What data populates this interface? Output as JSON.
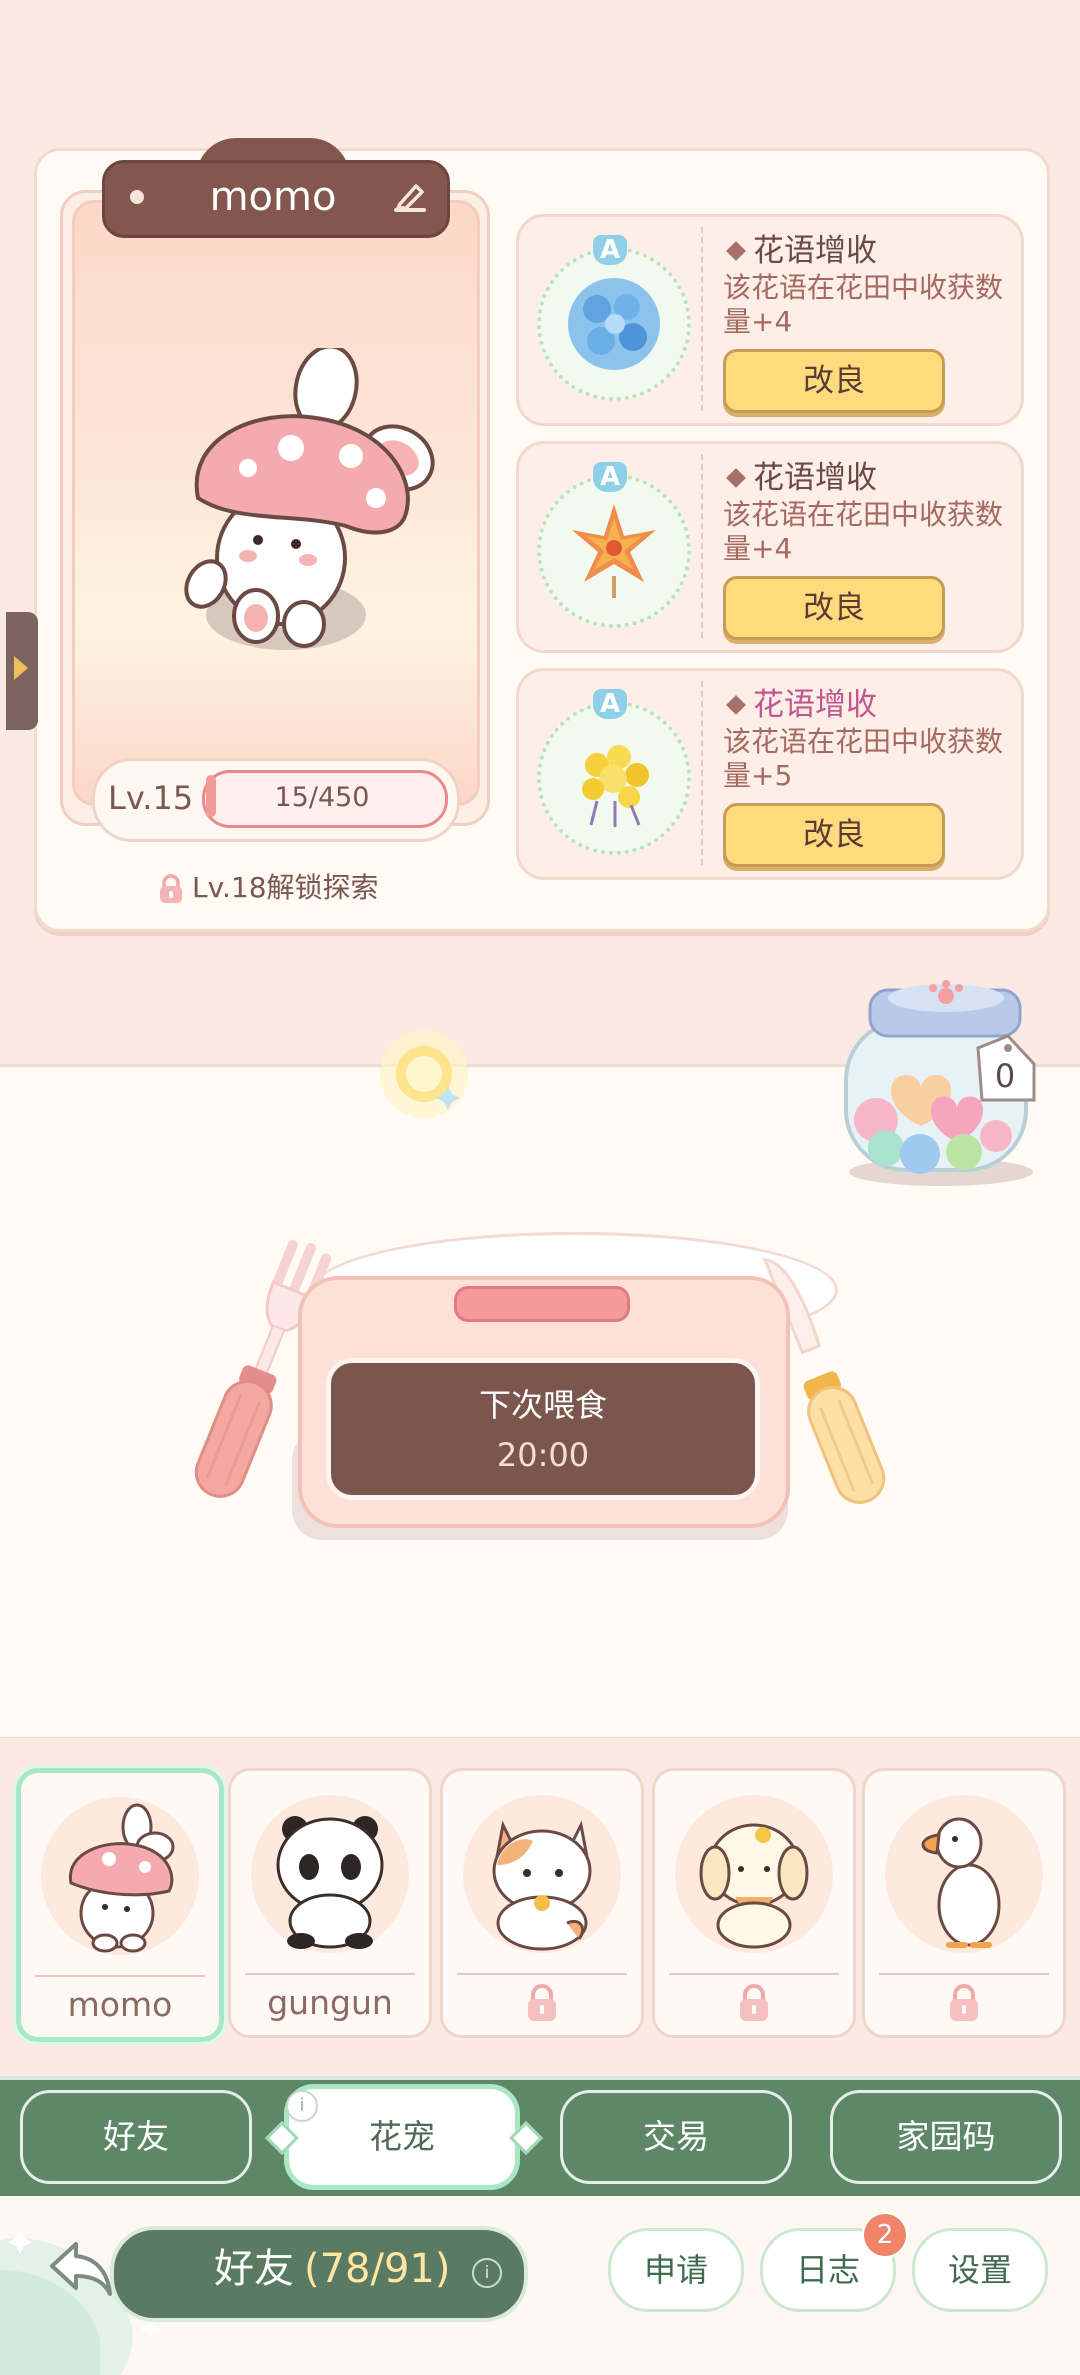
{
  "pet": {
    "name": "momo",
    "level_label": "Lv.15",
    "exp_text": "15/450",
    "exp_fraction": 0.033,
    "unlock_hint": "Lv.18解锁探索"
  },
  "traits": [
    {
      "grade": "A",
      "title": "花语增收",
      "title_color": "#6b4a44",
      "desc": "该花语在花田中收获数量+4",
      "button": "改良",
      "flower": "blue-hydrangea"
    },
    {
      "grade": "A",
      "title": "花语增收",
      "title_color": "#6b4a44",
      "desc": "该花语在花田中收获数量+4",
      "button": "改良",
      "flower": "orange-maple"
    },
    {
      "grade": "A",
      "title": "花语增收",
      "title_color": "#c1578f",
      "desc": "该花语在花田中收获数量+5",
      "button": "改良",
      "flower": "yellow-forsythia"
    }
  ],
  "jar": {
    "count": "0"
  },
  "feeding": {
    "label": "下次喂食",
    "time": "20:00"
  },
  "pets": [
    {
      "label": "momo",
      "locked": false,
      "selected": true,
      "icon": "mushroom-bunny"
    },
    {
      "label": "gungun",
      "locked": false,
      "selected": false,
      "icon": "panda"
    },
    {
      "label": "",
      "locked": true,
      "selected": false,
      "icon": "calico-cat"
    },
    {
      "label": "",
      "locked": true,
      "selected": false,
      "icon": "puppy"
    },
    {
      "label": "",
      "locked": true,
      "selected": false,
      "icon": "goose"
    }
  ],
  "tabs": [
    {
      "label": "好友",
      "active": false
    },
    {
      "label": "花宠",
      "active": true
    },
    {
      "label": "交易",
      "active": false
    },
    {
      "label": "家园码",
      "active": false
    }
  ],
  "bottom": {
    "friends_label": "好友",
    "friends_count": "(78/91)",
    "buttons": [
      "申请",
      "日志",
      "设置"
    ],
    "log_badge": "2"
  },
  "colors": {
    "accent_green": "#5e8768",
    "button_yellow": "#ffdb7d",
    "name_plate": "#83574d"
  }
}
